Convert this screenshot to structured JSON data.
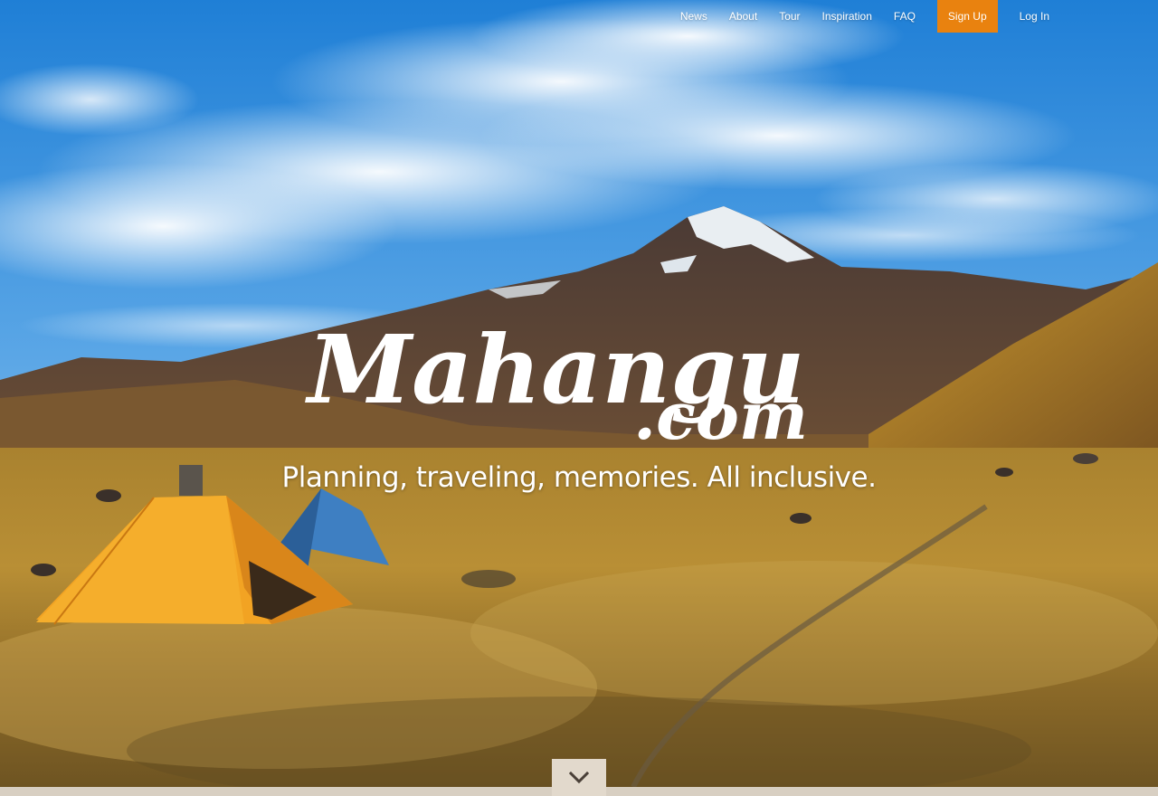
{
  "nav": {
    "items": [
      {
        "label": "News"
      },
      {
        "label": "About"
      },
      {
        "label": "Tour"
      },
      {
        "label": "Inspiration"
      },
      {
        "label": "FAQ"
      }
    ],
    "signup_label": "Sign Up",
    "login_label": "Log In"
  },
  "hero": {
    "logo_main": "Mahangu",
    "logo_suffix": ".com",
    "tagline": "Planning, traveling, memories. All inclusive.",
    "scroll_icon": "chevron-down-icon"
  },
  "colors": {
    "accent": "#e9820f",
    "footer": "#d8cfc2",
    "scroll_button": "#e2d9cc",
    "sky": "#2f86d6"
  }
}
